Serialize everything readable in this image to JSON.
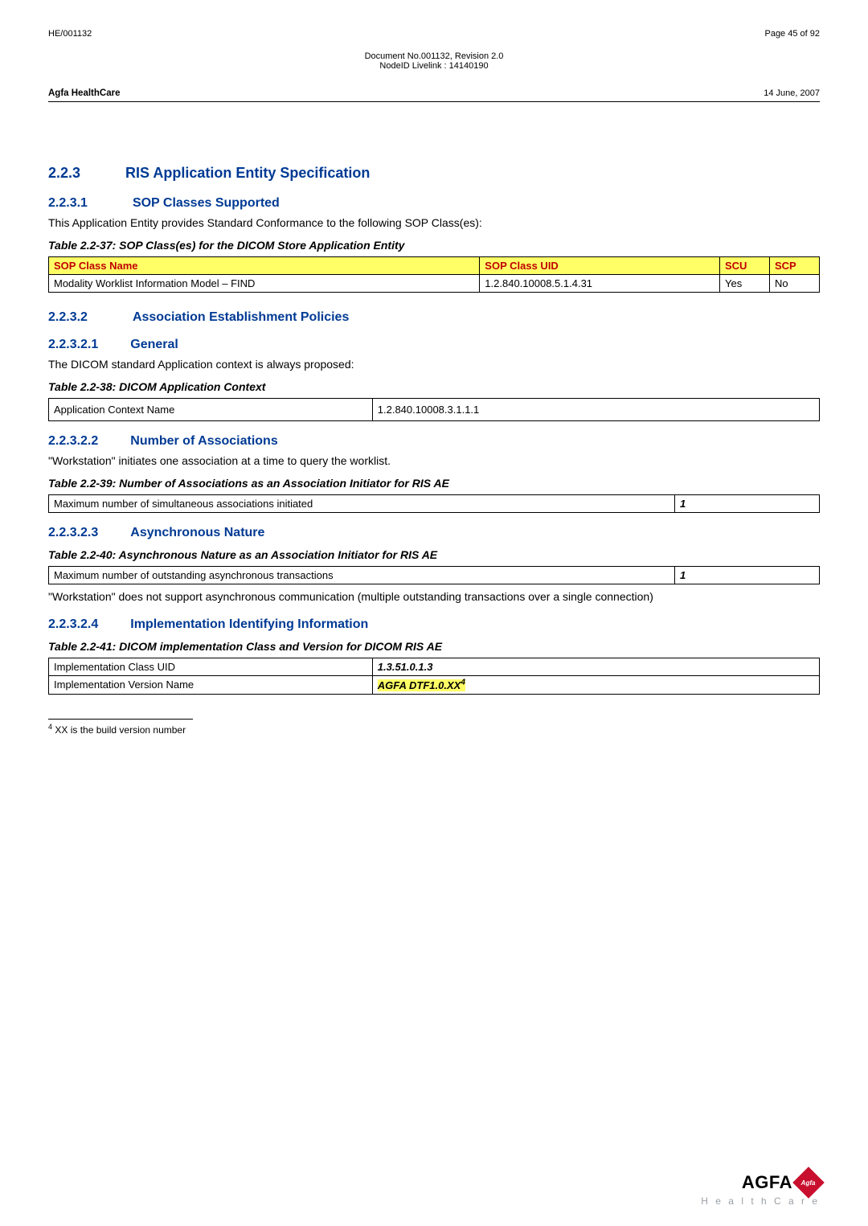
{
  "header": {
    "doc_ref": "HE/001132",
    "page_label": "Page 45 of 92",
    "doc_no_line1": "Document No.001132, Revision 2.0",
    "doc_no_line2": "NodeID Livelink : 14140190",
    "company": "Agfa HealthCare",
    "date": "14 June, 2007"
  },
  "sections": {
    "s223": {
      "num": "2.2.3",
      "title": "RIS Application Entity Specification"
    },
    "s2231": {
      "num": "2.2.3.1",
      "title": "SOP Classes Supported",
      "para": "This Application Entity provides Standard Conformance to the following SOP Class(es):"
    },
    "t37": {
      "caption": "Table 2.2-37: SOP Class(es) for the DICOM Store Application Entity",
      "cols": [
        "SOP Class Name",
        "SOP Class UID",
        "SCU",
        "SCP"
      ],
      "row": {
        "name": "Modality Worklist Information Model – FIND",
        "uid": "1.2.840.10008.5.1.4.31",
        "scu": "Yes",
        "scp": "No"
      }
    },
    "s2232": {
      "num": "2.2.3.2",
      "title": "Association Establishment Policies"
    },
    "s22321": {
      "num": "2.2.3.2.1",
      "title": "General",
      "para": "The DICOM standard Application context is always proposed:"
    },
    "t38": {
      "caption": "Table 2.2-38: DICOM Application Context",
      "row_label": "Application Context Name",
      "row_value": "1.2.840.10008.3.1.1.1"
    },
    "s22322": {
      "num": "2.2.3.2.2",
      "title": "Number of Associations",
      "para": "\"Workstation\" initiates one association at a time to query the worklist."
    },
    "t39": {
      "caption": "Table 2.2-39: Number of Associations as an Association Initiator for RIS AE",
      "row_label": "Maximum number of simultaneous associations initiated",
      "row_value": "1"
    },
    "s22323": {
      "num": "2.2.3.2.3",
      "title": "Asynchronous Nature"
    },
    "t40": {
      "caption": "Table 2.2-40: Asynchronous Nature as an Association Initiator for RIS AE",
      "row_label": "Maximum number of outstanding asynchronous transactions",
      "row_value": "1",
      "note": "\"Workstation\" does not support asynchronous communication (multiple outstanding transactions over a single connection)"
    },
    "s22324": {
      "num": "2.2.3.2.4",
      "title": "Implementation Identifying Information"
    },
    "t41": {
      "caption": "Table 2.2-41: DICOM implementation Class and Version for DICOM RIS AE",
      "r1_label": "Implementation Class UID",
      "r1_value": "1.3.51.0.1.3",
      "r2_label": "Implementation Version Name",
      "r2_value": "AGFA DTF1.0.XX",
      "r2_fn": "4"
    }
  },
  "footnote": {
    "marker": "4",
    "text": " XX is the build version number"
  },
  "logo": {
    "brand": "AGFA",
    "diamond_text": "Agfa",
    "subtitle": "H e a l t h C a r e"
  }
}
